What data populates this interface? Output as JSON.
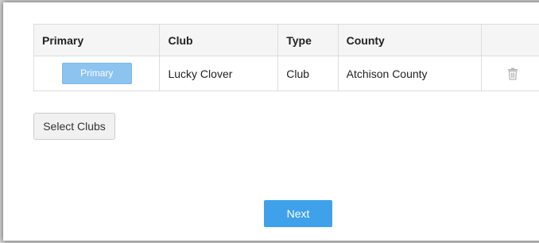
{
  "table": {
    "headers": {
      "primary": "Primary",
      "club": "Club",
      "type": "Type",
      "county": "County"
    },
    "rows": [
      {
        "primary_button": "Primary",
        "club": "Lucky Clover",
        "type": "Club",
        "county": "Atchison County",
        "action_icon": "trash-icon"
      }
    ]
  },
  "buttons": {
    "select_clubs": "Select Clubs",
    "next": "Next"
  },
  "colors": {
    "primary_button": "#8cc3ef",
    "next_button": "#3ea1ea"
  }
}
